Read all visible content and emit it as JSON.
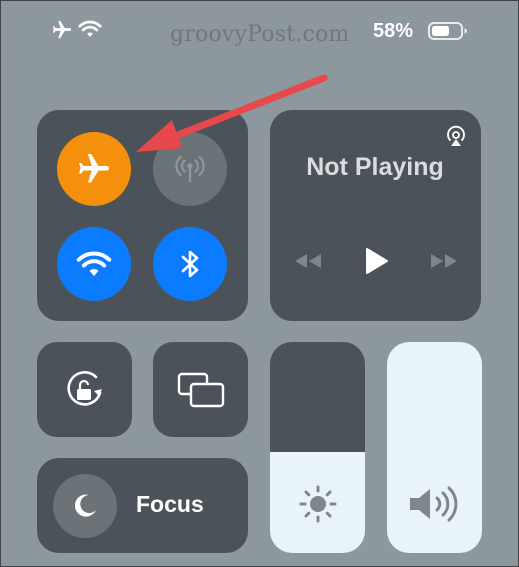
{
  "status_bar": {
    "icons": [
      "airplane-icon",
      "wifi-icon",
      "battery-icon"
    ],
    "battery_percent": "58%"
  },
  "watermark": "groovyPost.com",
  "connectivity": {
    "airplane": {
      "icon": "airplane-icon",
      "state": "on",
      "color": "#f5900c"
    },
    "cellular": {
      "icon": "cellular-antenna-icon",
      "state": "off",
      "color": "#6b7278"
    },
    "wifi": {
      "icon": "wifi-icon",
      "state": "on",
      "color": "#0b7bff"
    },
    "bluetooth": {
      "icon": "bluetooth-icon",
      "state": "on",
      "color": "#0b7bff"
    }
  },
  "media": {
    "status": "Not Playing",
    "airplay_icon": "airplay-icon",
    "controls": [
      "rewind-icon",
      "play-icon",
      "fast-forward-icon"
    ]
  },
  "controls": {
    "rotation_lock": "rotation-lock-icon",
    "screen_mirroring": "screen-mirroring-icon",
    "focus": {
      "icon": "moon-icon",
      "label": "Focus"
    }
  },
  "sliders": {
    "brightness": {
      "icon": "sun-icon",
      "level": 0.48
    },
    "volume": {
      "icon": "speaker-icon",
      "level": 1.0
    }
  },
  "annotation": {
    "arrow_color": "#e8484b",
    "points_to": "airplane-mode-button"
  },
  "colors": {
    "background": "#8d979e",
    "panel": "#4b5259",
    "slider_fill": "#e8f4f8"
  }
}
